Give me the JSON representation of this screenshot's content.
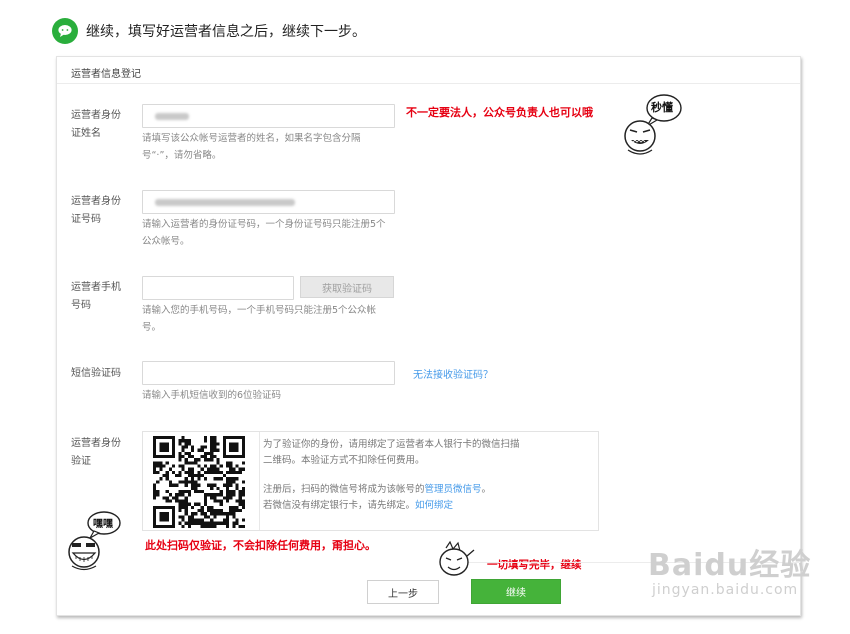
{
  "header": {
    "instruction": "继续，填写好运营者信息之后，继续下一步。",
    "icon": "wechat-chat-icon"
  },
  "form": {
    "section_title": "运营者信息登记",
    "name": {
      "label_l1": "运营者身份",
      "label_l2": "证姓名",
      "hint_l1": "请填写该公众帐号运营者的姓名，如果名字包含分隔",
      "hint_l2": "号“·”，请勿省略。"
    },
    "id_number": {
      "label_l1": "运营者身份",
      "label_l2": "证号码",
      "hint_l1": "请输入运营者的身份证号码，一个身份证号码只能注册5个",
      "hint_l2": "公众帐号。"
    },
    "phone": {
      "label_l1": "运营者手机",
      "label_l2": "号码",
      "button": "获取验证码",
      "hint_l1": "请输入您的手机号码，一个手机号码只能注册5个公众帐",
      "hint_l2": "号。"
    },
    "sms": {
      "label": "短信验证码",
      "link": "无法接收验证码？",
      "hint": "请输入手机短信收到的6位验证码"
    },
    "verify": {
      "label_l1": "运营者身份",
      "label_l2": "验证",
      "text_l1": "为了验证你的身份，请用绑定了运营者本人银行卡的微信扫描",
      "text_l2": "二维码。本验证方式不扣除任何费用。",
      "text_l3_pre": "注册后，扫码的微信号将成为该帐号的",
      "text_l3_link": "管理员微信号",
      "text_l3_post": "。",
      "text_l4_pre": "若微信没有绑定银行卡，请先绑定。",
      "text_l4_link": "如何绑定"
    },
    "buttons": {
      "prev": "上一步",
      "next": "继续"
    }
  },
  "annotations": {
    "note_name": "不一定要法人，公众号负责人也可以哦",
    "note_verify": "此处扫码仅验证，不会扣除任何费用，甭担心。",
    "note_continue": "一切填写完毕，继续",
    "sticker_top": "秒懂",
    "sticker_left": "嘿嘿"
  },
  "watermark": {
    "logo": "Baidu经验",
    "url": "jingyan.baidu.com"
  },
  "colors": {
    "wechat_green": "#2aae3c",
    "button_green": "#45b33a",
    "link_blue": "#459ae9",
    "annotation_red": "#e60012"
  }
}
